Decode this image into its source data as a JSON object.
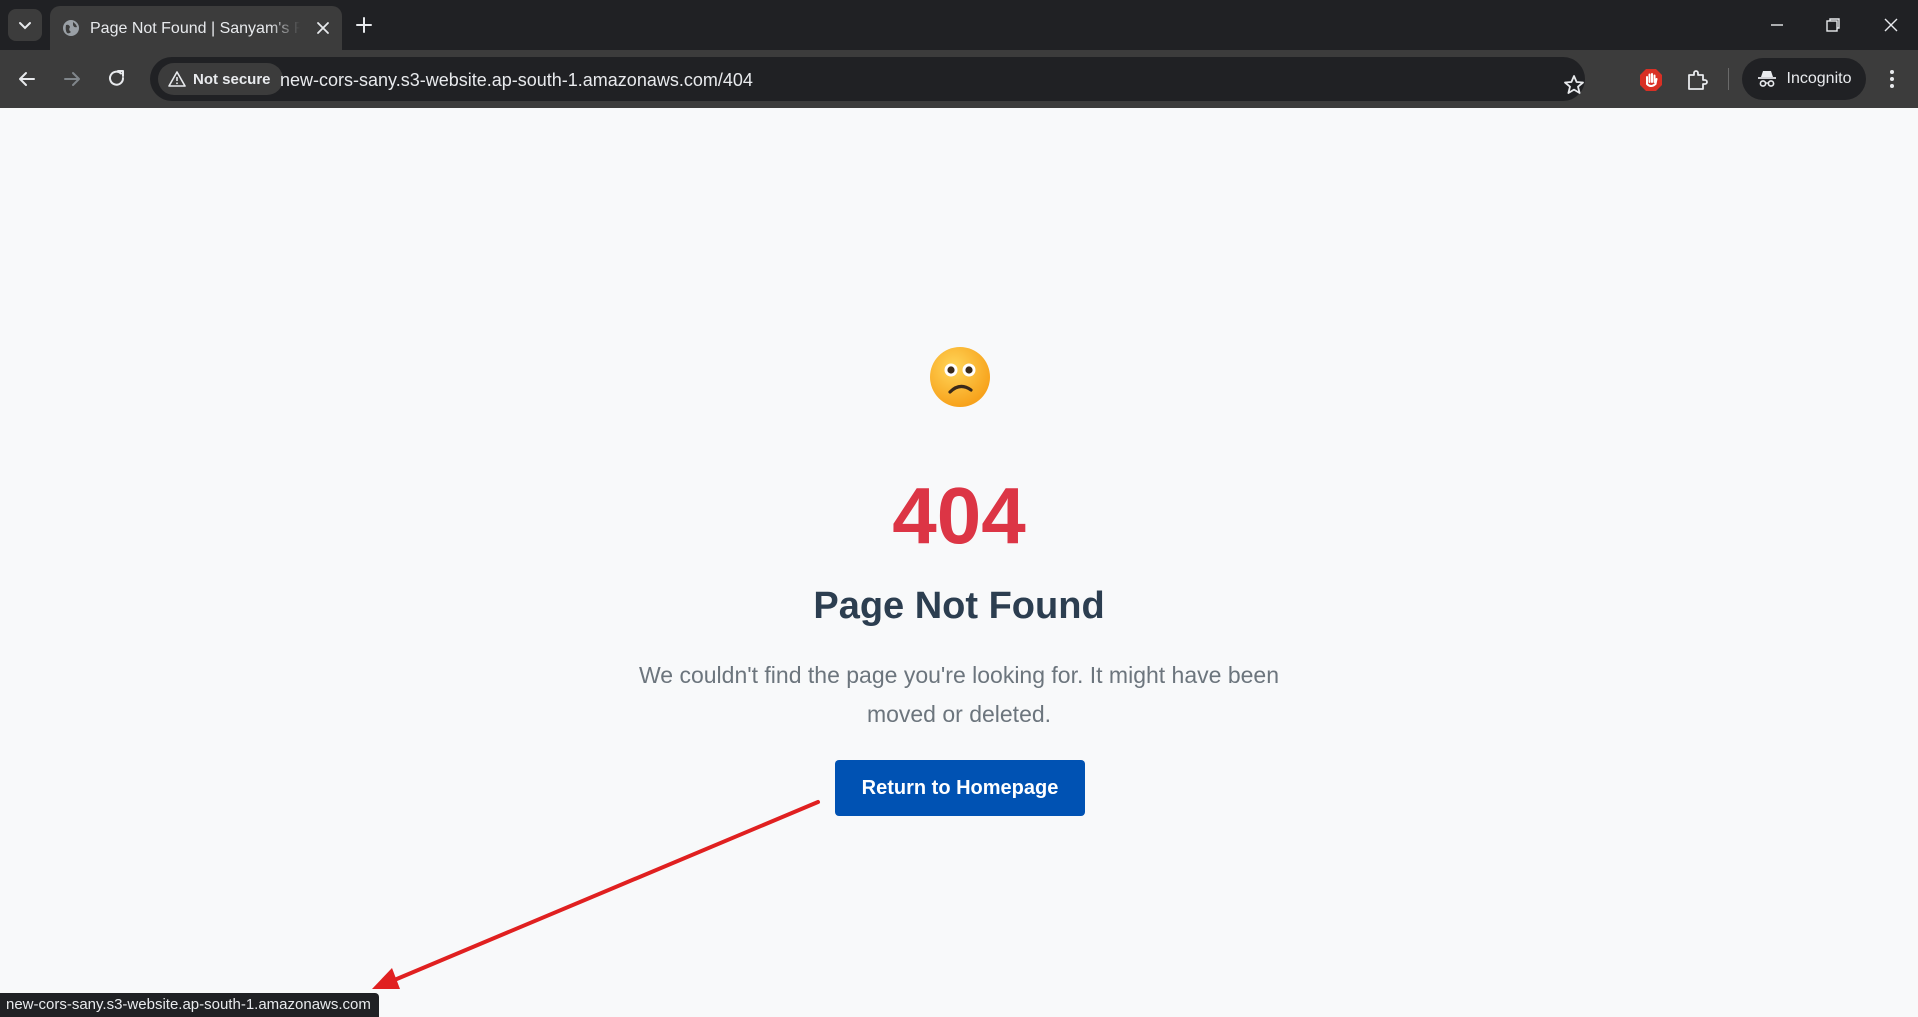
{
  "browser": {
    "tab_title": "Page Not Found | Sanyam's First Website",
    "security_label": "Not secure",
    "url": "new-cors-sany.s3-website.ap-south-1.amazonaws.com/404",
    "profile_label": "Incognito",
    "status_url": "new-cors-sany.s3-website.ap-south-1.amazonaws.com"
  },
  "page": {
    "emoji_icon": "confused-face-icon",
    "error_code": "404",
    "heading": "Page Not Found",
    "message": "We couldn't find the page you're looking for. It might have been moved or deleted.",
    "button_label": "Return to Homepage"
  },
  "colors": {
    "error_code": "#dc3545",
    "heading": "#2c3e50",
    "button": "#0052b3",
    "annotation_arrow": "#e02020"
  }
}
